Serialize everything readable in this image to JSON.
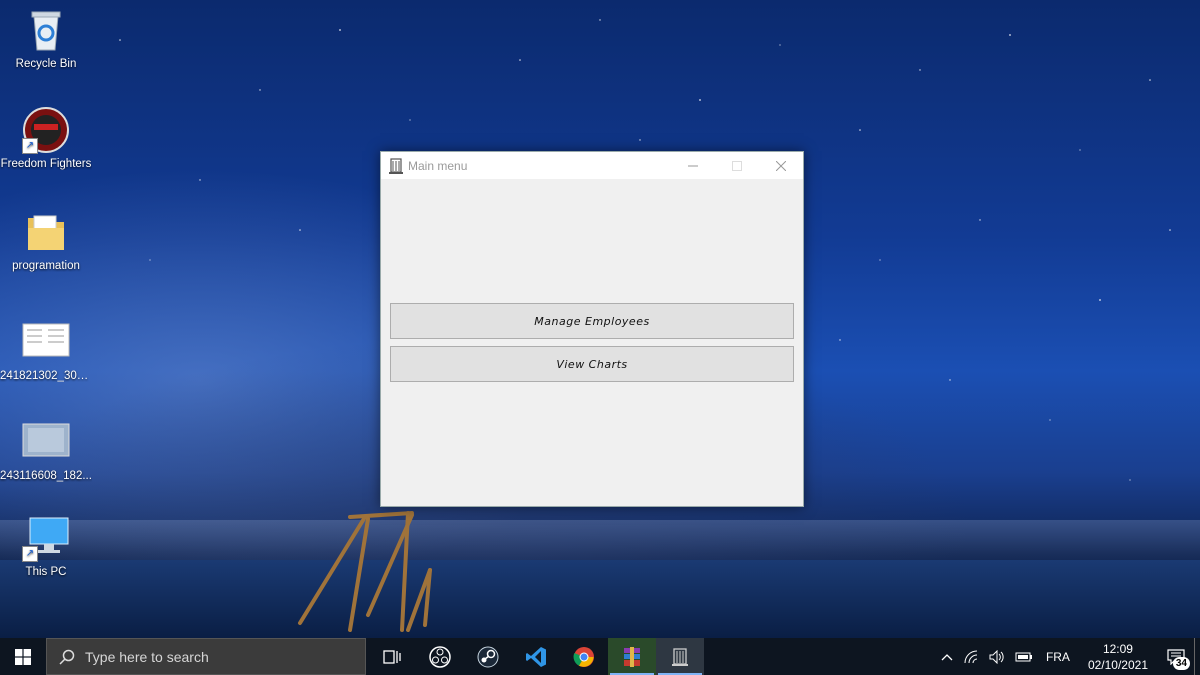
{
  "desktop": {
    "icons": [
      {
        "label": "Recycle Bin",
        "icon": "recycle-bin-icon"
      },
      {
        "label": "Freedom Fighters",
        "icon": "freedom-fighters-icon"
      },
      {
        "label": "programation",
        "icon": "folder-icon"
      },
      {
        "label": "241821302_303...",
        "icon": "image-file-icon"
      },
      {
        "label": "243116608_182...",
        "icon": "image-file-icon"
      },
      {
        "label": "This PC",
        "icon": "this-pc-icon"
      }
    ]
  },
  "window": {
    "title": "Main menu",
    "buttons": {
      "manage_employees": "Manage Employees",
      "view_charts": "View Charts"
    }
  },
  "taskbar": {
    "search_placeholder": "Type here to search",
    "apps": [
      "task-view-icon",
      "obs-icon",
      "steam-icon",
      "vscode-icon",
      "chrome-icon",
      "winrar-icon",
      "python-app-icon"
    ],
    "tray": {
      "language": "FRA",
      "time": "12:09",
      "date": "02/10/2021",
      "notification_count": "34"
    }
  }
}
